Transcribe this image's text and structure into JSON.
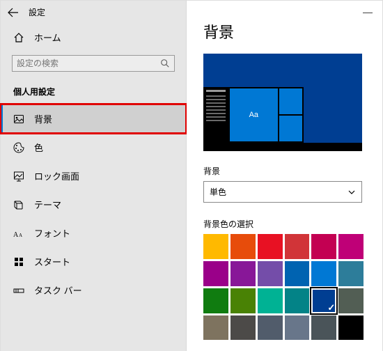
{
  "titlebar": {
    "title": "設定"
  },
  "home": {
    "label": "ホーム"
  },
  "search": {
    "placeholder": "設定の検索"
  },
  "category": {
    "header": "個人用設定"
  },
  "nav": {
    "items": [
      {
        "label": "背景"
      },
      {
        "label": "色"
      },
      {
        "label": "ロック画面"
      },
      {
        "label": "テーマ"
      },
      {
        "label": "フォント"
      },
      {
        "label": "スタート"
      },
      {
        "label": "タスク バー"
      }
    ]
  },
  "main": {
    "title": "背景",
    "preview_tile_text": "Aa",
    "field_label": "背景",
    "field_value": "単色",
    "swatch_label": "背景色の選択",
    "swatches": [
      [
        "#ffb900",
        "#e74c0b",
        "#e81123",
        "#d13438",
        "#c30052",
        "#bf0077"
      ],
      [
        "#9a0089",
        "#881798",
        "#744da9",
        "#0063b1",
        "#0078d4",
        "#2d7d9a"
      ],
      [
        "#107c10",
        "#498205",
        "#00b294",
        "#038387",
        "#003e92",
        "#525e54"
      ],
      [
        "#7e735f",
        "#4c4a48",
        "#515c6b",
        "#68768a",
        "#4a5459",
        "#000000"
      ]
    ],
    "selected_swatch": [
      2,
      4
    ]
  }
}
